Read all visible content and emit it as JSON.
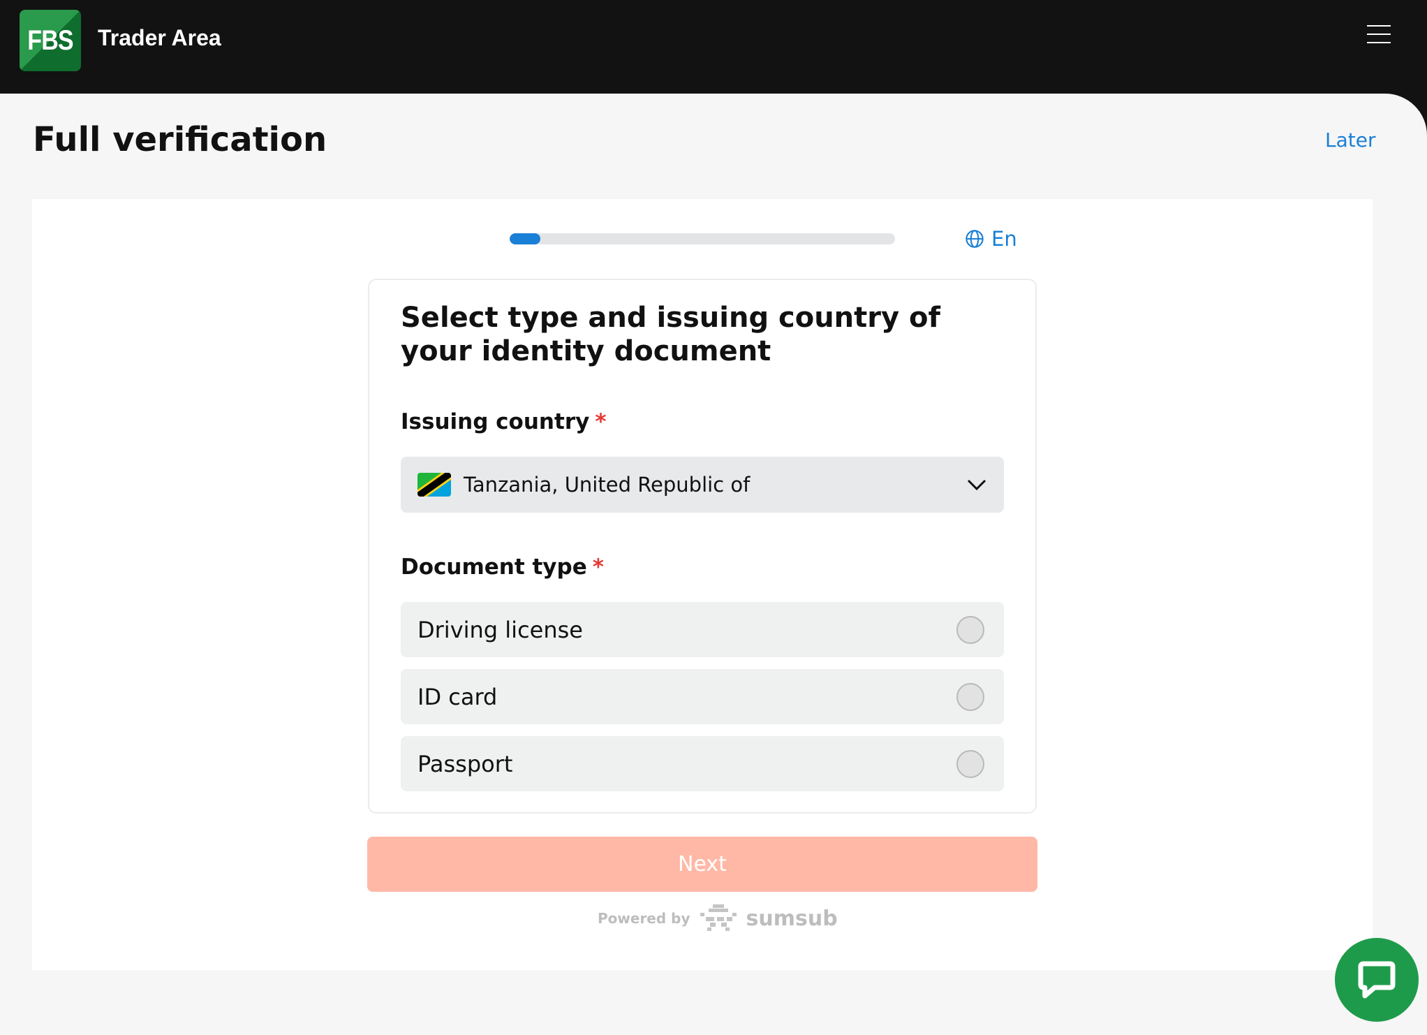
{
  "header": {
    "logo_text": "FBS",
    "title": "Trader Area"
  },
  "page": {
    "title": "Full verification",
    "later_label": "Later"
  },
  "progress": {
    "fraction": 0.08,
    "color": "#1a7fd6"
  },
  "language": {
    "label": "En",
    "icon": "globe-icon"
  },
  "form": {
    "heading": "Select type and issuing country of your identity document",
    "country_label": "Issuing country",
    "required_mark": "*",
    "country_value": "Tanzania, United Republic of",
    "doc_label": "Document type",
    "options": [
      {
        "label": "Driving license",
        "selected": false
      },
      {
        "label": "ID card",
        "selected": false
      },
      {
        "label": "Passport",
        "selected": false
      }
    ],
    "next_label": "Next"
  },
  "footer": {
    "powered_by": "Powered by",
    "brand": "sumsub"
  },
  "colors": {
    "accent": "#1a7fd6",
    "button_disabled": "#ffb8a6",
    "chat": "#1e9b4a",
    "required": "#e53935"
  }
}
